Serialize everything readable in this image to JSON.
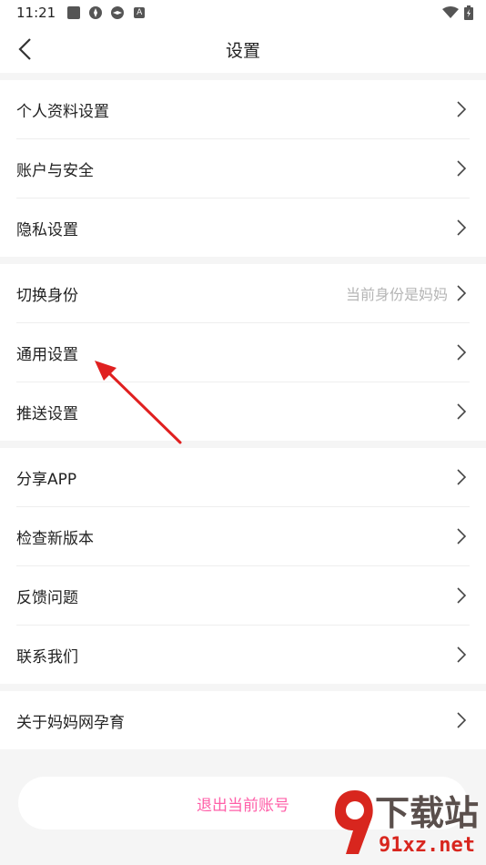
{
  "status_bar": {
    "time": "11:21",
    "icons": [
      "square-icon",
      "pinwheel-icon",
      "pinwheel-icon",
      "font-a-icon"
    ],
    "right_icons": [
      "wifi-icon",
      "battery-charging-icon"
    ]
  },
  "header": {
    "title": "设置",
    "back_icon": "chevron-left-icon"
  },
  "groups": [
    {
      "items": [
        {
          "label": "个人资料设置"
        },
        {
          "label": "账户与安全"
        },
        {
          "label": "隐私设置"
        }
      ]
    },
    {
      "items": [
        {
          "label": "切换身份",
          "hint": "当前身份是妈妈"
        },
        {
          "label": "通用设置"
        },
        {
          "label": "推送设置"
        }
      ]
    },
    {
      "items": [
        {
          "label": "分享APP"
        },
        {
          "label": "检查新版本"
        },
        {
          "label": "反馈问题"
        },
        {
          "label": "联系我们"
        }
      ]
    },
    {
      "items": [
        {
          "label": "关于妈妈网孕育"
        }
      ]
    }
  ],
  "logout": {
    "label": "退出当前账号",
    "color": "#ff5fa8"
  },
  "annotation": {
    "type": "red-arrow",
    "target": "通用设置",
    "color": "#e02020"
  },
  "watermark": {
    "line1": "下载站",
    "line2": "91xz.net",
    "badge": "9"
  }
}
